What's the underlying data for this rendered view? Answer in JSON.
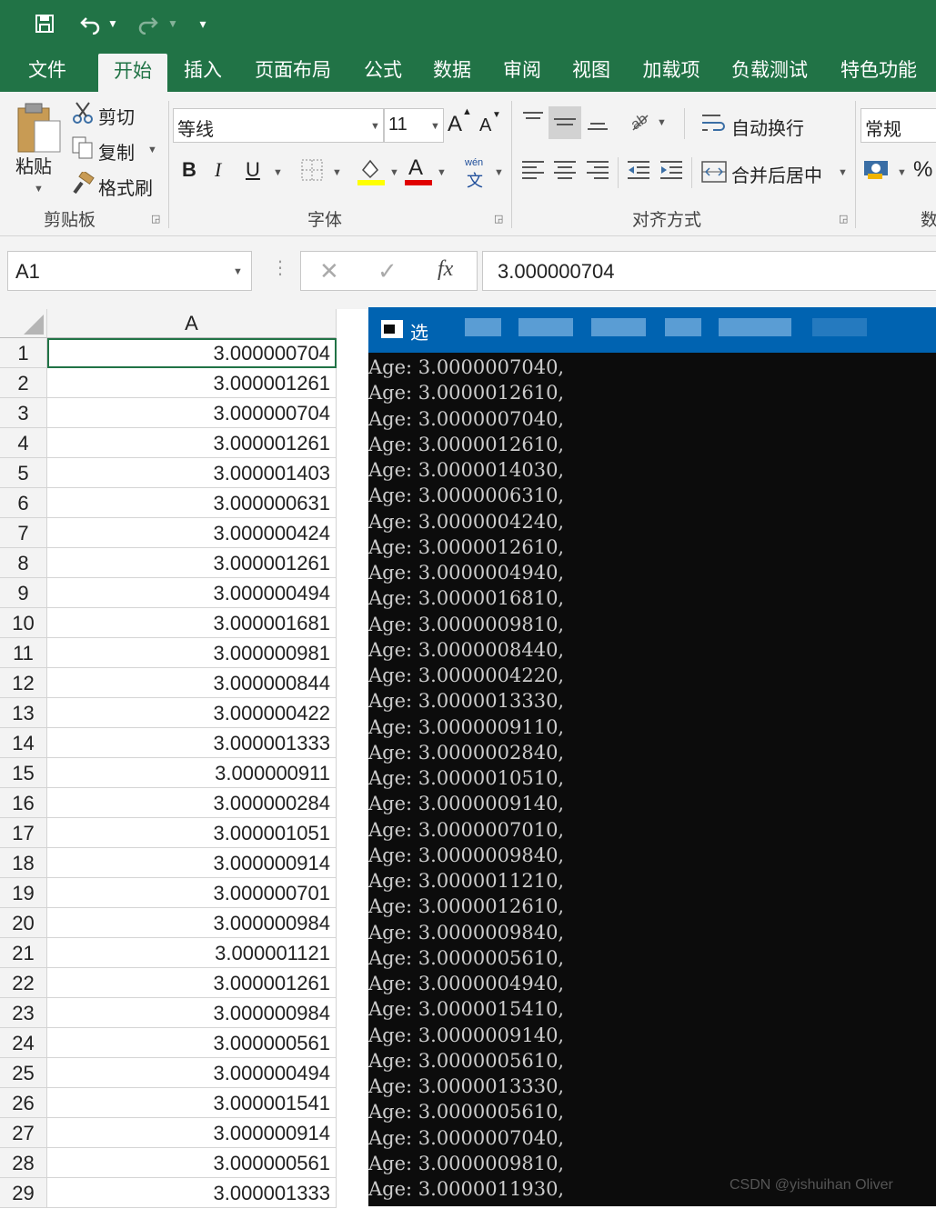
{
  "ribbon": {
    "tabs": [
      {
        "label": "文件"
      },
      {
        "label": "开始"
      },
      {
        "label": "插入"
      },
      {
        "label": "页面布局"
      },
      {
        "label": "公式"
      },
      {
        "label": "数据"
      },
      {
        "label": "审阅"
      },
      {
        "label": "视图"
      },
      {
        "label": "加载项"
      },
      {
        "label": "负载测试"
      },
      {
        "label": "特色功能"
      }
    ],
    "clipboard": {
      "paste": "粘贴",
      "cut": "剪切",
      "copy": "复制",
      "format_painter": "格式刷",
      "label": "剪贴板"
    },
    "font": {
      "name": "等线",
      "size": "11",
      "label": "字体",
      "bold": "B",
      "italic": "I",
      "underline": "U",
      "grow": "A",
      "shrink": "A",
      "phonetic_top": "wén",
      "phonetic_bottom": "文",
      "font_color_glyph": "A"
    },
    "alignment": {
      "wrap": "自动换行",
      "merge": "合并后居中",
      "label": "对齐方式"
    },
    "number": {
      "format": "常规",
      "label": "数",
      "percent": "%"
    }
  },
  "formula_bar": {
    "name_box": "A1",
    "fx": "fx",
    "value": "3.000000704"
  },
  "sheet": {
    "column_header": "A",
    "rows": [
      {
        "n": "1",
        "v": "3.000000704"
      },
      {
        "n": "2",
        "v": "3.000001261"
      },
      {
        "n": "3",
        "v": "3.000000704"
      },
      {
        "n": "4",
        "v": "3.000001261"
      },
      {
        "n": "5",
        "v": "3.000001403"
      },
      {
        "n": "6",
        "v": "3.000000631"
      },
      {
        "n": "7",
        "v": "3.000000424"
      },
      {
        "n": "8",
        "v": "3.000001261"
      },
      {
        "n": "9",
        "v": "3.000000494"
      },
      {
        "n": "10",
        "v": "3.000001681"
      },
      {
        "n": "11",
        "v": "3.000000981"
      },
      {
        "n": "12",
        "v": "3.000000844"
      },
      {
        "n": "13",
        "v": "3.000000422"
      },
      {
        "n": "14",
        "v": "3.000001333"
      },
      {
        "n": "15",
        "v": "3.000000911"
      },
      {
        "n": "16",
        "v": "3.000000284"
      },
      {
        "n": "17",
        "v": "3.000001051"
      },
      {
        "n": "18",
        "v": "3.000000914"
      },
      {
        "n": "19",
        "v": "3.000000701"
      },
      {
        "n": "20",
        "v": "3.000000984"
      },
      {
        "n": "21",
        "v": "3.000001121"
      },
      {
        "n": "22",
        "v": "3.000001261"
      },
      {
        "n": "23",
        "v": "3.000000984"
      },
      {
        "n": "24",
        "v": "3.000000561"
      },
      {
        "n": "25",
        "v": "3.000000494"
      },
      {
        "n": "26",
        "v": "3.000001541"
      },
      {
        "n": "27",
        "v": "3.000000914"
      },
      {
        "n": "28",
        "v": "3.000000561"
      },
      {
        "n": "29",
        "v": "3.000001333"
      }
    ]
  },
  "console": {
    "title_glyph": "选",
    "lines": [
      "Age: 3.0000007040,",
      "Age: 3.0000012610,",
      "Age: 3.0000007040,",
      "Age: 3.0000012610,",
      "Age: 3.0000014030,",
      "Age: 3.0000006310,",
      "Age: 3.0000004240,",
      "Age: 3.0000012610,",
      "Age: 3.0000004940,",
      "Age: 3.0000016810,",
      "Age: 3.0000009810,",
      "Age: 3.0000008440,",
      "Age: 3.0000004220,",
      "Age: 3.0000013330,",
      "Age: 3.0000009110,",
      "Age: 3.0000002840,",
      "Age: 3.0000010510,",
      "Age: 3.0000009140,",
      "Age: 3.0000007010,",
      "Age: 3.0000009840,",
      "Age: 3.0000011210,",
      "Age: 3.0000012610,",
      "Age: 3.0000009840,",
      "Age: 3.0000005610,",
      "Age: 3.0000004940,",
      "Age: 3.0000015410,",
      "Age: 3.0000009140,",
      "Age: 3.0000005610,",
      "Age: 3.0000013330,",
      "Age: 3.0000005610,",
      "Age: 3.0000007040,",
      "Age: 3.0000009810,",
      "Age: 3.0000011930,"
    ]
  },
  "watermark": "CSDN @yishuihan Oliver",
  "colors": {
    "excel_green": "#217346",
    "console_bg": "#0c0c0c",
    "console_title": "#0063b1"
  }
}
